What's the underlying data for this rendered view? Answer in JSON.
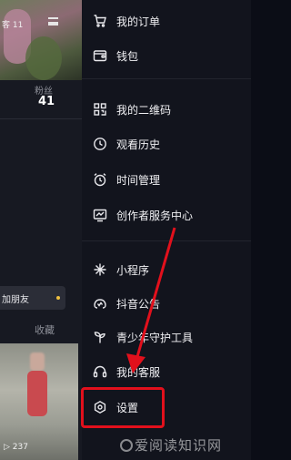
{
  "background_page": {
    "top_label": "客 11",
    "fans_label": "粉丝",
    "fans_count": "41",
    "add_friend": "加朋友",
    "collect_tab": "收藏",
    "video_play_count": "237"
  },
  "drawer": {
    "items": [
      {
        "icon": "cart-icon",
        "label": "我的订单"
      },
      {
        "icon": "wallet-icon",
        "label": "钱包"
      },
      {
        "icon": "qrcode-icon",
        "label": "我的二维码"
      },
      {
        "icon": "history-clock-icon",
        "label": "观看历史"
      },
      {
        "icon": "alarm-clock-icon",
        "label": "时间管理"
      },
      {
        "icon": "creator-chart-icon",
        "label": "创作者服务中心"
      },
      {
        "icon": "mini-program-icon",
        "label": "小程序"
      },
      {
        "icon": "notice-icon",
        "label": "抖音公告"
      },
      {
        "icon": "sprout-icon",
        "label": "青少年守护工具"
      },
      {
        "icon": "headset-icon",
        "label": "我的客服"
      },
      {
        "icon": "settings-hexagon-icon",
        "label": "设置"
      }
    ]
  },
  "annotation": {
    "highlight_color": "#e2101c",
    "highlighted_item": "设置"
  },
  "watermark": {
    "text": "爱阅读知识网"
  }
}
